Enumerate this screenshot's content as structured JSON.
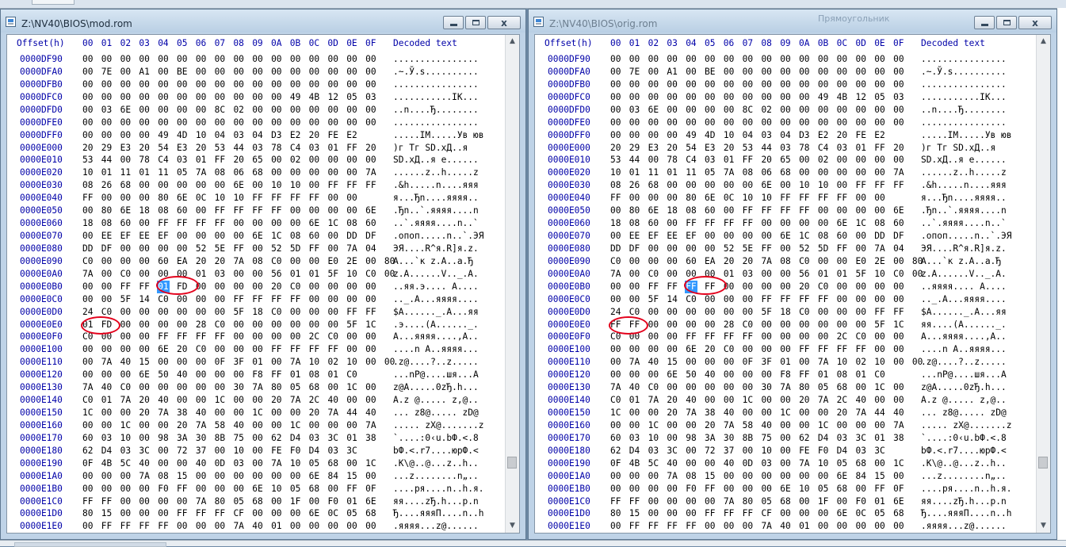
{
  "windows": {
    "left": {
      "title": "Z:\\NV40\\BIOS\\mod.rom",
      "header": {
        "offset": "Offset(h)",
        "decoded": "Decoded text",
        "cols": [
          "00",
          "01",
          "02",
          "03",
          "04",
          "05",
          "06",
          "07",
          "08",
          "09",
          "0A",
          "0B",
          "0C",
          "0D",
          "0E",
          "0F"
        ]
      },
      "rows": [
        {
          "o": "0000DF90",
          "h": "00 00 00 00 00 00 00 00 00 00 00 00 00 00 00 00",
          "t": "................"
        },
        {
          "o": "0000DFA0",
          "h": "00 7E 00 A1 00 BE 00 00 00 00 00 00 00 00 00 00",
          "t": ".~.Ў.ѕ.........."
        },
        {
          "o": "0000DFB0",
          "h": "00 00 00 00 00 00 00 00 00 00 00 00 00 00 00 00",
          "t": "................"
        },
        {
          "o": "0000DFC0",
          "h": "00 00 00 00 00 00 00 00 00 00 00 49 4B 12 05 03",
          "t": "...........IK..."
        },
        {
          "o": "0000DFD0",
          "h": "00 03 6E 00 00 00 00 8C 02 00 00 00 00 00 00 00",
          "t": "..n....Ђ........"
        },
        {
          "o": "0000DFE0",
          "h": "00 00 00 00 00 00 00 00 00 00 00 00 00 00 00 00",
          "t": "................"
        },
        {
          "o": "0000DFF0",
          "h": "00 00 00 00 49 4D 10 04 03 04 D3 E2 20 FE E2",
          "t": ".....IM.....Ув юв"
        },
        {
          "o": "0000E000",
          "h": "20 29 E3 20 54 E3 20 53 44 03 78 C4 03 01 FF 20",
          "t": " )г Tг SD.xД..я "
        },
        {
          "o": "0000E010",
          "h": "53 44 00 78 C4 03 01 FF 20 65 00 02 00 00 00 00",
          "t": "SD.xД..я e......"
        },
        {
          "o": "0000E020",
          "h": "10 01 11 01 11 05 7A 08 06 68 00 00 00 00 00 7A",
          "t": "......z..h.....z"
        },
        {
          "o": "0000E030",
          "h": "08 26 68 00 00 00 00 00 6E 00 10 10 00 FF FF FF",
          "t": ".&h.....n....яяя"
        },
        {
          "o": "0000E040",
          "h": "FF 00 00 00 80 6E 0C 10 10 FF FF FF FF 00 00",
          "t": "я...Ђn....яяяя.."
        },
        {
          "o": "0000E050",
          "h": "00 80 6E 18 08 60 00 FF FF FF FF 00 00 00 00 6E",
          "t": ".Ђn..`.яяяя....n"
        },
        {
          "o": "0000E060",
          "h": "18 08 60 00 FF FF FF FF 00 00 00 00 6E 1C 08 60",
          "t": "..`.яяяя....n..`"
        },
        {
          "o": "0000E070",
          "h": "00 EE EF EE EF 00 00 00 00 6E 1C 08 60 00 DD DF",
          "t": ".опоп.....n..`.ЭЯ"
        },
        {
          "o": "0000E080",
          "h": "DD DF 00 00 00 00 52 5E FF 00 52 5D FF 00 7A 04",
          "t": "ЭЯ....R^я.R]я.z."
        },
        {
          "o": "0000E090",
          "h": "C0 00 00 00 60 EA 20 20 7A 08 C0 00 00 E0 2E 00 80",
          "t": "А...`к  z.А..а.Ђ"
        },
        {
          "o": "0000E0A0",
          "h": "7A 00 C0 00 00 00 01 03 00 00 56 01 01 5F 10 C0 00",
          "t": "z.А......V.._.А."
        },
        {
          "o": "0000E0B0",
          "h": "00 00 FF FF 01 FD 00 00 00 00 20 C0 00 00 00 00",
          "t": "..яя.э.... А...."
        },
        {
          "o": "0000E0C0",
          "h": "00 00 5F 14 C0 00 00 00 FF FF FF FF 00 00 00 00",
          "t": ".._.А...яяяя...."
        },
        {
          "o": "0000E0D0",
          "h": "24 C0 00 00 00 00 00 00 5F 18 C0 00 00 00 FF FF",
          "t": "$А......_.А...яя"
        },
        {
          "o": "0000E0E0",
          "h": "01 FD 00 00 00 00 28 C0 00 00 00 00 00 00 5F 1C",
          "t": ".э....(А......_."
        },
        {
          "o": "0000E0F0",
          "h": "C0 00 00 00 FF FF FF FF 00 00 00 00 2C C0 00 00",
          "t": "А...яяяя....,А.."
        },
        {
          "o": "0000E100",
          "h": "00 00 00 00 6E 20 C0 00 00 00 FF FF FF FF 00 00",
          "t": "....n А..яяяя..."
        },
        {
          "o": "0000E110",
          "h": "00 7A 40 15 00 00 00 0F 3F 01 00 7A 10 02 10 00 00",
          "t": ".z@....?..z....."
        },
        {
          "o": "0000E120",
          "h": "00 00 00 6E 50 40 00 00 00 F8 FF 01 08 01 C0",
          "t": "...nP@....шя...А"
        },
        {
          "o": "0000E130",
          "h": "7A 40 C0 00 00 00 00 00 30 7A 80 05 68 00 1C 00",
          "t": "z@А.....0zЂ.h..."
        },
        {
          "o": "0000E140",
          "h": "C0 01 7A 20 40 00 00 1C 00 00 20 7A 2C 40 00 00",
          "t": "А.z @..... z,@.."
        },
        {
          "o": "0000E150",
          "h": "1C 00 00 20 7A 38 40 00 00 1C 00 00 20 7A 44 40",
          "t": "... z8@..... zD@"
        },
        {
          "o": "0000E160",
          "h": "00 00 1C 00 00 20 7A 58 40 00 00 1C 00 00 00 7A",
          "t": "..... zX@.......z"
        },
        {
          "o": "0000E170",
          "h": "60 03 10 00 98 3A 30 8B 75 00 62 D4 03 3C 01 38",
          "t": "`....:0‹u.bФ.<.8"
        },
        {
          "o": "0000E180",
          "h": "62 D4 03 3C 00 72 37 00 10 00 FE F0 D4 03 3C",
          "t": "bФ.<.r7....юрФ.<"
        },
        {
          "o": "0000E190",
          "h": "0F 4B 5C 40 00 00 40 0D 03 00 7A 10 05 68 00 1C",
          "t": ".K\\@..@...z..h.."
        },
        {
          "o": "0000E1A0",
          "h": "00 00 00 7A 08 15 00 00 00 00 00 00 6E 84 15 00",
          "t": "...z........n„.."
        },
        {
          "o": "0000E1B0",
          "h": "00 00 00 00 F0 FF 00 00 00 6E 10 05 68 00 FF 0F",
          "t": "....ря....n..h.я."
        },
        {
          "o": "0000E1C0",
          "h": "FF FF 00 00 00 00 7A 80 05 68 00 1F 00 F0 01 6E",
          "t": "яя....zЂ.h...р.n"
        },
        {
          "o": "0000E1D0",
          "h": "80 15 00 00 00 FF FF FF CF 00 00 00 6E 0C 05 68",
          "t": "Ђ....яяяП....n..h"
        },
        {
          "o": "0000E1E0",
          "h": "00 FF FF FF FF 00 00 00 7A 40 01 00 00 00 00 00",
          "t": ".яяяя...z@......"
        }
      ],
      "highlight": "01"
    },
    "right": {
      "title": "Z:\\NV40\\BIOS\\orig.rom",
      "ghost_text": "Прямоугольник",
      "header": {
        "offset": "Offset(h)",
        "decoded": "Decoded text",
        "cols": [
          "00",
          "01",
          "02",
          "03",
          "04",
          "05",
          "06",
          "07",
          "08",
          "09",
          "0A",
          "0B",
          "0C",
          "0D",
          "0E",
          "0F"
        ]
      },
      "rows": [
        {
          "o": "0000DF90",
          "h": "00 00 00 00 00 00 00 00 00 00 00 00 00 00 00 00",
          "t": "................"
        },
        {
          "o": "0000DFA0",
          "h": "00 7E 00 A1 00 BE 00 00 00 00 00 00 00 00 00 00",
          "t": ".~.Ў.ѕ.........."
        },
        {
          "o": "0000DFB0",
          "h": "00 00 00 00 00 00 00 00 00 00 00 00 00 00 00 00",
          "t": "................"
        },
        {
          "o": "0000DFC0",
          "h": "00 00 00 00 00 00 00 00 00 00 00 49 4B 12 05 03",
          "t": "...........IK..."
        },
        {
          "o": "0000DFD0",
          "h": "00 03 6E 00 00 00 00 8C 02 00 00 00 00 00 00 00",
          "t": "..n....Ђ........"
        },
        {
          "o": "0000DFE0",
          "h": "00 00 00 00 00 00 00 00 00 00 00 00 00 00 00 00",
          "t": "................"
        },
        {
          "o": "0000DFF0",
          "h": "00 00 00 00 49 4D 10 04 03 04 D3 E2 20 FE E2",
          "t": ".....IM.....Ув юв"
        },
        {
          "o": "0000E000",
          "h": "20 29 E3 20 54 E3 20 53 44 03 78 C4 03 01 FF 20",
          "t": " )г Tг SD.xД..я "
        },
        {
          "o": "0000E010",
          "h": "53 44 00 78 C4 03 01 FF 20 65 00 02 00 00 00 00",
          "t": "SD.xД..я e......"
        },
        {
          "o": "0000E020",
          "h": "10 01 11 01 11 05 7A 08 06 68 00 00 00 00 00 7A",
          "t": "......z..h.....z"
        },
        {
          "o": "0000E030",
          "h": "08 26 68 00 00 00 00 00 6E 00 10 10 00 FF FF FF",
          "t": ".&h.....n....яяя"
        },
        {
          "o": "0000E040",
          "h": "FF 00 00 00 80 6E 0C 10 10 FF FF FF FF 00 00",
          "t": "я...Ђn....яяяя.."
        },
        {
          "o": "0000E050",
          "h": "00 80 6E 18 08 60 00 FF FF FF FF 00 00 00 00 6E",
          "t": ".Ђn..`.яяяя....n"
        },
        {
          "o": "0000E060",
          "h": "18 08 60 00 FF FF FF FF 00 00 00 00 6E 1C 08 60",
          "t": "..`.яяяя....n..`"
        },
        {
          "o": "0000E070",
          "h": "00 EE EF EE EF 00 00 00 00 6E 1C 08 60 00 DD DF",
          "t": ".опоп.....n..`.ЭЯ"
        },
        {
          "o": "0000E080",
          "h": "DD DF 00 00 00 00 52 5E FF 00 52 5D FF 00 7A 04",
          "t": "ЭЯ....R^я.R]я.z."
        },
        {
          "o": "0000E090",
          "h": "C0 00 00 00 60 EA 20 20 7A 08 C0 00 00 E0 2E 00 80",
          "t": "А...`к  z.А..а.Ђ"
        },
        {
          "o": "0000E0A0",
          "h": "7A 00 C0 00 00 00 01 03 00 00 56 01 01 5F 10 C0 00",
          "t": "z.А......V.._.А."
        },
        {
          "o": "0000E0B0",
          "h": "00 00 FF FF FF FF 00 00 00 00 20 C0 00 00 00 00",
          "t": "..яяяя.... А...."
        },
        {
          "o": "0000E0C0",
          "h": "00 00 5F 14 C0 00 00 00 FF FF FF FF 00 00 00 00",
          "t": ".._.А...яяяя...."
        },
        {
          "o": "0000E0D0",
          "h": "24 C0 00 00 00 00 00 00 5F 18 C0 00 00 00 FF FF",
          "t": "$А......_.А...яя"
        },
        {
          "o": "0000E0E0",
          "h": "FF FF 00 00 00 00 28 C0 00 00 00 00 00 00 5F 1C",
          "t": "яя....(А......_."
        },
        {
          "o": "0000E0F0",
          "h": "C0 00 00 00 FF FF FF FF 00 00 00 00 2C C0 00 00",
          "t": "А...яяяя....,А.."
        },
        {
          "o": "0000E100",
          "h": "00 00 00 00 6E 20 C0 00 00 00 FF FF FF FF 00 00",
          "t": "....n А..яяяя..."
        },
        {
          "o": "0000E110",
          "h": "00 7A 40 15 00 00 00 0F 3F 01 00 7A 10 02 10 00 00",
          "t": ".z@....?..z....."
        },
        {
          "o": "0000E120",
          "h": "00 00 00 6E 50 40 00 00 00 F8 FF 01 08 01 C0",
          "t": "...nP@....шя...А"
        },
        {
          "o": "0000E130",
          "h": "7A 40 C0 00 00 00 00 00 30 7A 80 05 68 00 1C 00",
          "t": "z@А.....0zЂ.h..."
        },
        {
          "o": "0000E140",
          "h": "C0 01 7A 20 40 00 00 1C 00 00 20 7A 2C 40 00 00",
          "t": "А.z @..... z,@.."
        },
        {
          "o": "0000E150",
          "h": "1C 00 00 20 7A 38 40 00 00 1C 00 00 20 7A 44 40",
          "t": "... z8@..... zD@"
        },
        {
          "o": "0000E160",
          "h": "00 00 1C 00 00 20 7A 58 40 00 00 1C 00 00 00 7A",
          "t": "..... zX@.......z"
        },
        {
          "o": "0000E170",
          "h": "60 03 10 00 98 3A 30 8B 75 00 62 D4 03 3C 01 38",
          "t": "`....:0‹u.bФ.<.8"
        },
        {
          "o": "0000E180",
          "h": "62 D4 03 3C 00 72 37 00 10 00 FE F0 D4 03 3C",
          "t": "bФ.<.r7....юрФ.<"
        },
        {
          "o": "0000E190",
          "h": "0F 4B 5C 40 00 00 40 0D 03 00 7A 10 05 68 00 1C",
          "t": ".K\\@..@...z..h.."
        },
        {
          "o": "0000E1A0",
          "h": "00 00 00 7A 08 15 00 00 00 00 00 00 6E 84 15 00",
          "t": "...z........n„.."
        },
        {
          "o": "0000E1B0",
          "h": "00 00 00 00 F0 FF 00 00 00 6E 10 05 68 00 FF 0F",
          "t": "....ря....n..h.я."
        },
        {
          "o": "0000E1C0",
          "h": "FF FF 00 00 00 00 7A 80 05 68 00 1F 00 F0 01 6E",
          "t": "яя....zЂ.h...р.n"
        },
        {
          "o": "0000E1D0",
          "h": "80 15 00 00 00 FF FF FF CF 00 00 00 6E 0C 05 68",
          "t": "Ђ....яяяП....n..h"
        },
        {
          "o": "0000E1E0",
          "h": "00 FF FF FF FF 00 00 00 7A 40 01 00 00 00 00 00",
          "t": ".яяяя...z@......"
        }
      ],
      "highlight": "FF"
    }
  },
  "buttons": {
    "minimize": "minimize",
    "maximize": "maximize",
    "close": "x"
  },
  "scrollbar": {
    "up": "▲",
    "down": "▼",
    "position": 0.92
  },
  "colors": {
    "offset_blue": "#0000a8",
    "selection": "#3399ff",
    "annotation_red": "#e3001b"
  }
}
